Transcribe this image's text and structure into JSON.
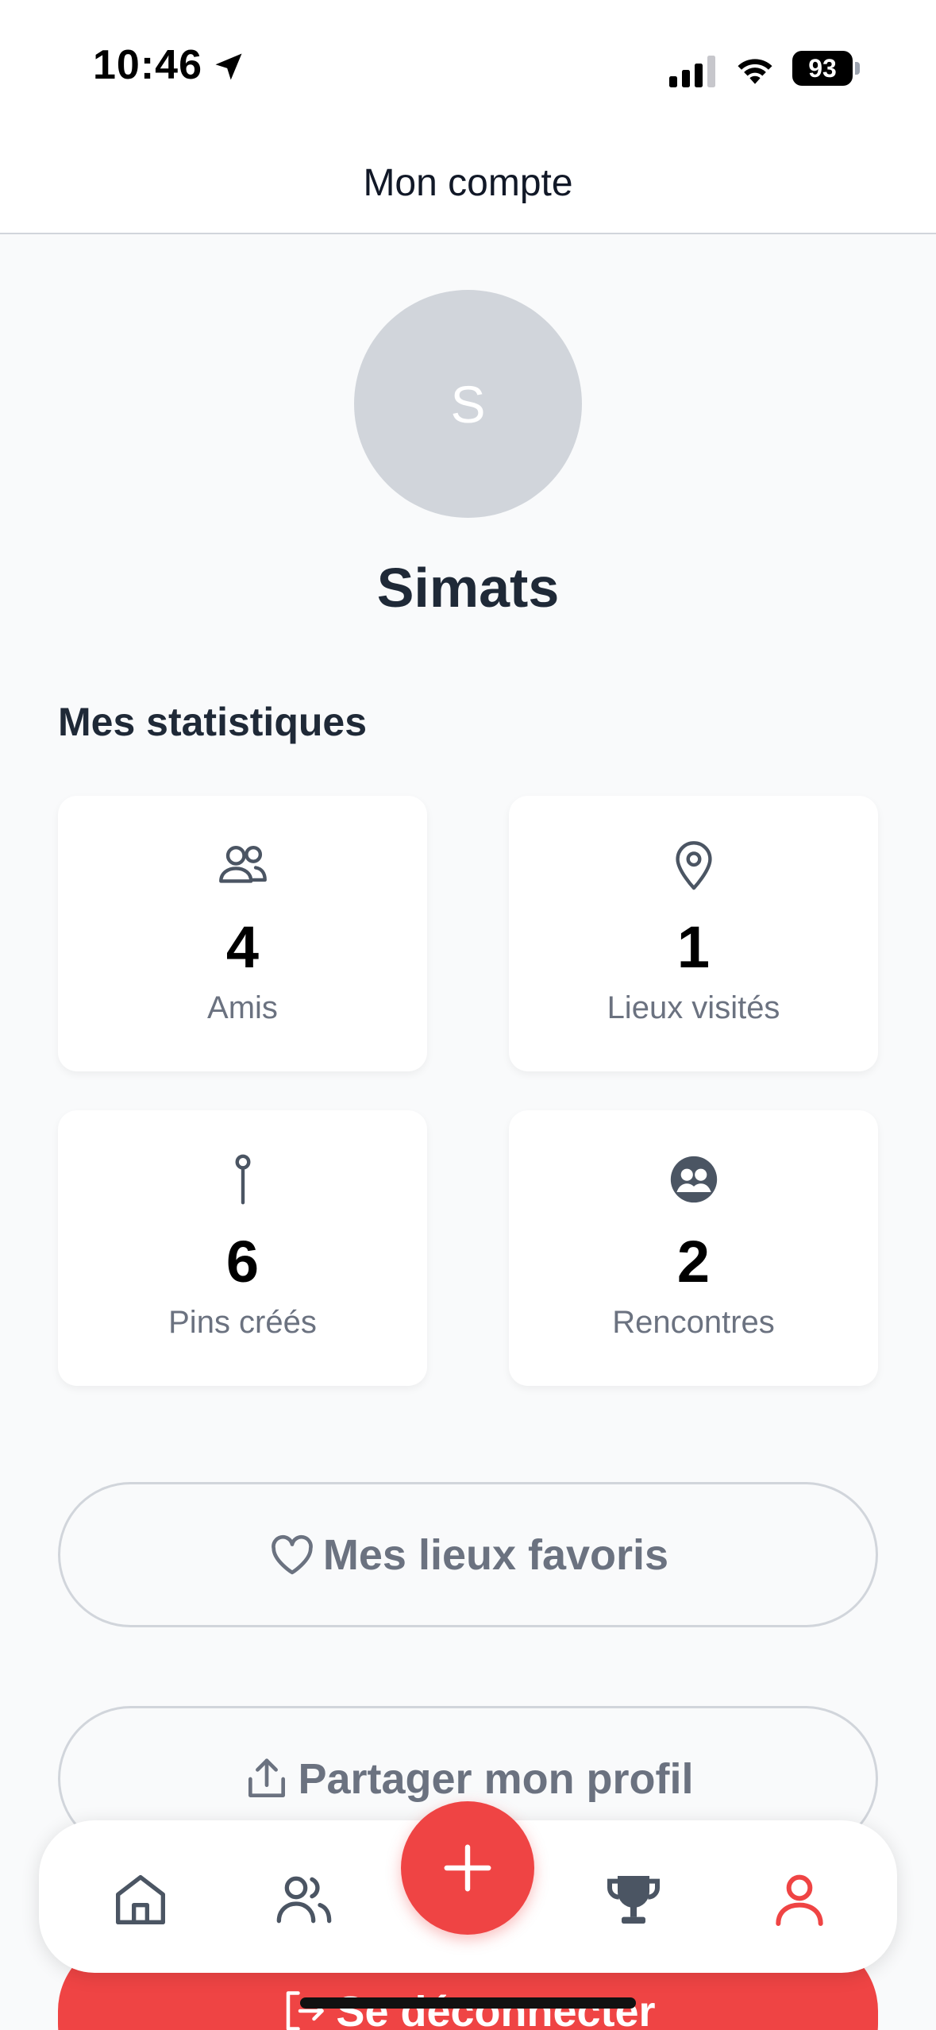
{
  "status_bar": {
    "time": "10:46",
    "battery": "93"
  },
  "header": {
    "title": "Mon compte"
  },
  "profile": {
    "avatar_initial": "S",
    "name": "Simats"
  },
  "stats": {
    "title": "Mes statistiques",
    "items": [
      {
        "icon": "friends-icon",
        "value": "4",
        "label": "Amis"
      },
      {
        "icon": "map-pin-icon",
        "value": "1",
        "label": "Lieux visités"
      },
      {
        "icon": "pushpin-icon",
        "value": "6",
        "label": "Pins créés"
      },
      {
        "icon": "people-circle-icon",
        "value": "2",
        "label": "Rencontres"
      }
    ]
  },
  "actions": {
    "favorites_label": "Mes lieux favoris",
    "share_label": "Partager mon profil",
    "logout_label": "Se déconnecter"
  },
  "tab_bar": {
    "tabs": [
      {
        "name": "home-icon"
      },
      {
        "name": "friends-icon"
      },
      {
        "name": "add-icon"
      },
      {
        "name": "trophy-icon"
      },
      {
        "name": "profile-icon",
        "active": true
      }
    ]
  },
  "colors": {
    "accent": "#ef4444",
    "background": "#f9fafb",
    "text_dark": "#1f2937",
    "text_muted": "#6b7280",
    "icon_gray": "#4b5563"
  }
}
